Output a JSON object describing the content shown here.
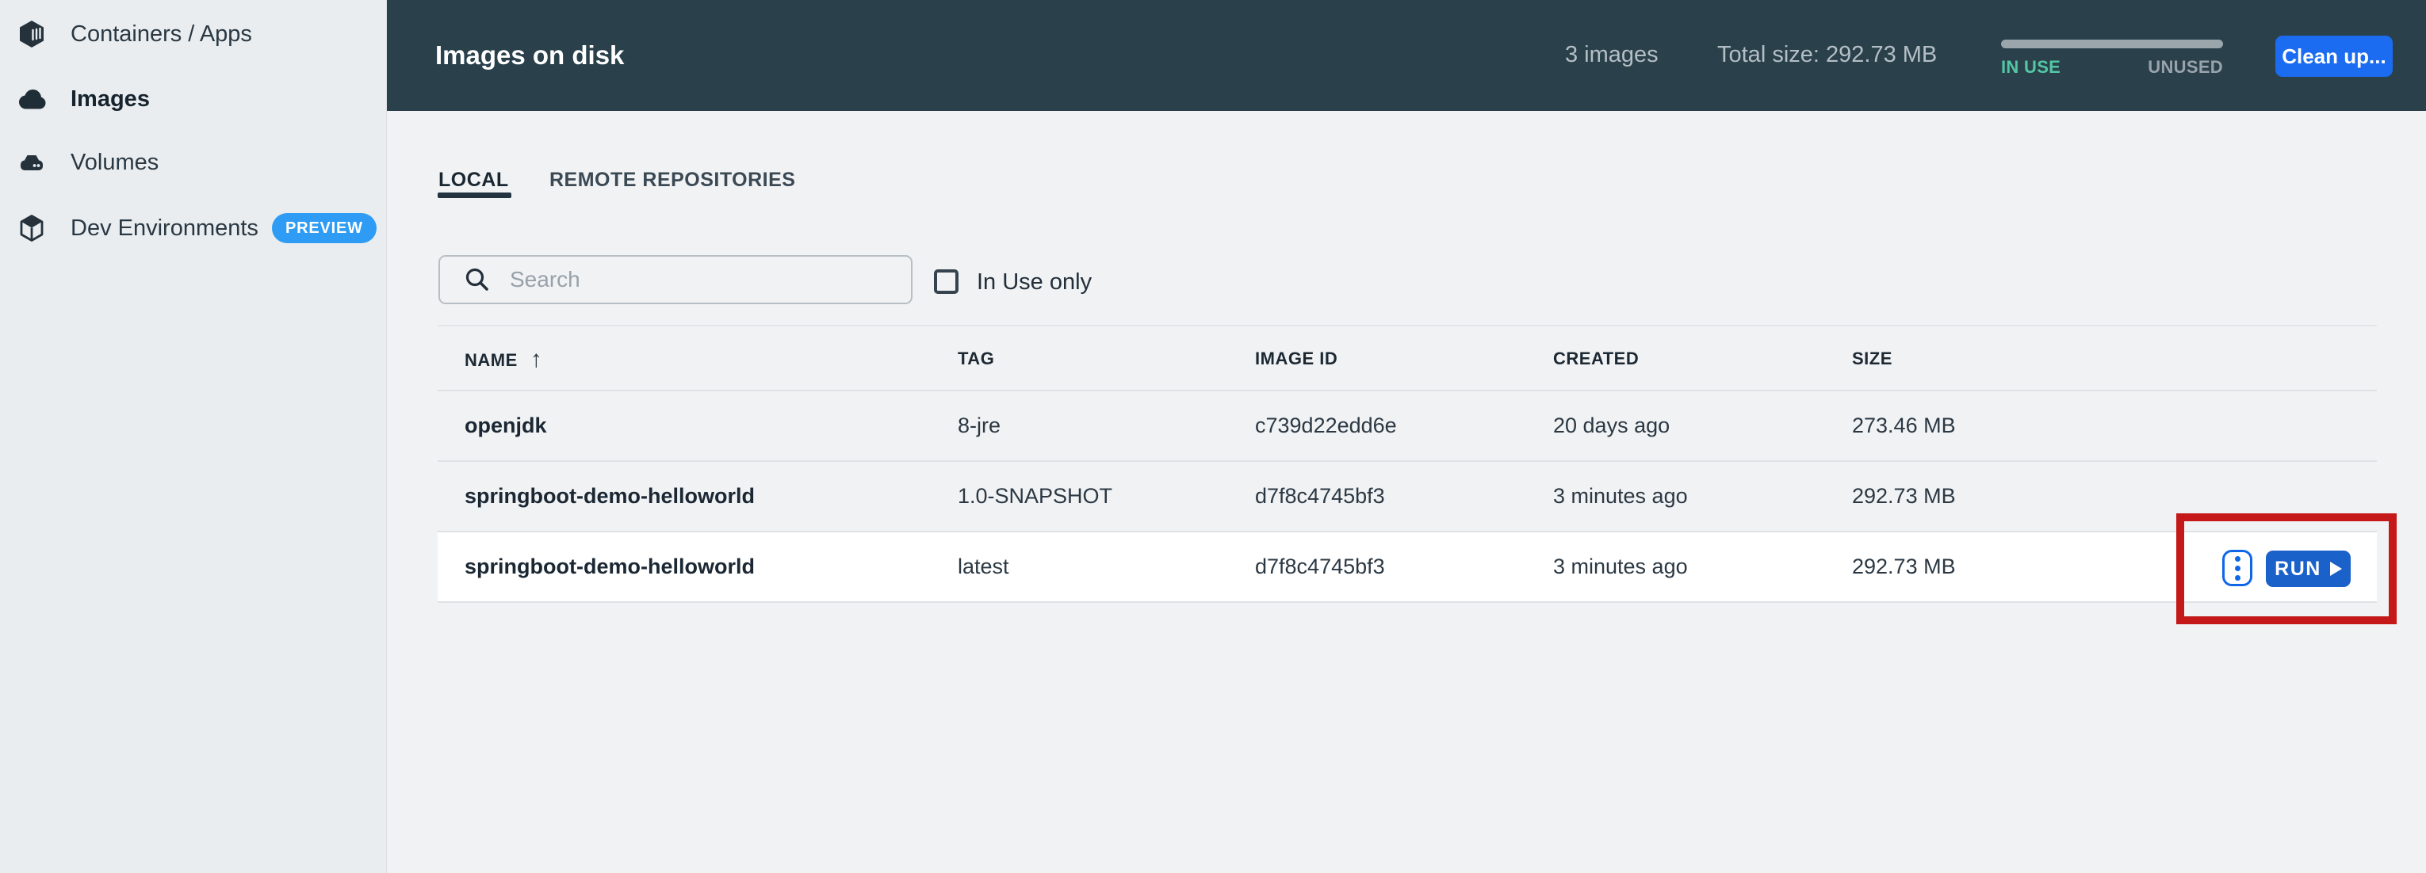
{
  "sidebar": {
    "items": [
      {
        "label": "Containers / Apps",
        "icon": "container-box-icon",
        "selected": false
      },
      {
        "label": "Images",
        "icon": "images-cloud-icon",
        "selected": true
      },
      {
        "label": "Volumes",
        "icon": "volume-drive-icon",
        "selected": false
      },
      {
        "label": "Dev Environments",
        "icon": "dev-cube-icon",
        "selected": false,
        "badge": "PREVIEW"
      }
    ]
  },
  "header": {
    "title": "Images on disk",
    "image_count": "3 images",
    "total_size": "Total size: 292.73 MB",
    "gauge": {
      "in_use_label": "IN USE",
      "unused_label": "UNUSED"
    },
    "cleanup_label": "Clean up..."
  },
  "tabs": {
    "local": "LOCAL",
    "remote": "REMOTE REPOSITORIES"
  },
  "toolbar": {
    "search_placeholder": "Search",
    "in_use_only_label": "In Use only"
  },
  "table": {
    "columns": {
      "name": "NAME",
      "tag": "TAG",
      "image_id": "IMAGE ID",
      "created": "CREATED",
      "size": "SIZE"
    },
    "sort": {
      "column": "NAME",
      "direction": "ascending",
      "arrow": "↑"
    },
    "rows": [
      {
        "name": "openjdk",
        "tag": "8-jre",
        "image_id": "c739d22edd6e",
        "created": "20 days ago",
        "size": "273.46 MB"
      },
      {
        "name": "springboot-demo-helloworld",
        "tag": "1.0-SNAPSHOT",
        "image_id": "d7f8c4745bf3",
        "created": "3 minutes ago",
        "size": "292.73 MB"
      },
      {
        "name": "springboot-demo-helloworld",
        "tag": "latest",
        "image_id": "d7f8c4745bf3",
        "created": "3 minutes ago",
        "size": "292.73 MB"
      }
    ]
  },
  "row_actions": {
    "run_label": "RUN"
  },
  "colors": {
    "header_bg": "#2a414c",
    "sidebar_bg": "#e9edef",
    "content_bg": "#f1f2f4",
    "accent_blue": "#1b6cf0",
    "run_blue": "#1a61ca",
    "badge_blue": "#2e9cf4",
    "in_use_green": "#53c7a4",
    "gauge_gray": "#9ba5ac",
    "annotation_red": "#c51919"
  }
}
